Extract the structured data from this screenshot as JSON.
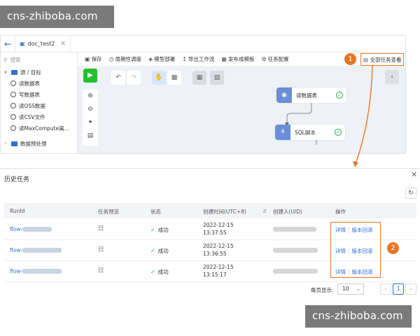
{
  "watermark": "cns-zhiboba.com",
  "tab": {
    "title": "doc_test2"
  },
  "search": {
    "placeholder": "搜索"
  },
  "tree": [
    {
      "label": "源 / 目标"
    },
    {
      "label": "读数据表"
    },
    {
      "label": "写数据表"
    },
    {
      "label": "读OSS数据"
    },
    {
      "label": "读CSV文件"
    },
    {
      "label": "读MaxCompute离..."
    },
    {
      "label": "数据预处理"
    }
  ],
  "toolbar": {
    "save": "保存",
    "schedule": "周期性调度",
    "deploy": "模型部署",
    "export": "导出工作流",
    "publish": "发布成模板",
    "config": "任务配置",
    "all_tasks": "全部任务查看"
  },
  "nodes": [
    {
      "label": "读数据表"
    },
    {
      "label": "SQL脚本"
    }
  ],
  "badges": {
    "one": "1",
    "two": "2"
  },
  "history": {
    "title": "历史任务",
    "columns": {
      "runid": "RunId",
      "preview": "任务预览",
      "status": "状态",
      "created": "创建时间(UTC+8)",
      "creator": "创建人(UID)",
      "ops": "操作"
    },
    "rows": [
      {
        "runid": "flow-",
        "status": "成功",
        "date": "2022-12-15",
        "time": "13:37:55",
        "detail": "详情",
        "rollback": "版本回滚"
      },
      {
        "runid": "flow-",
        "status": "成功",
        "date": "2022-12-15",
        "time": "13:36:55",
        "detail": "详情",
        "rollback": "版本回滚"
      },
      {
        "runid": "flow-",
        "status": "成功",
        "date": "2022-12-15",
        "time": "13:15:17",
        "detail": "详情",
        "rollback": "版本回滚"
      }
    ],
    "pager": {
      "per_page_label": "每页显示:",
      "per_page": "10",
      "page": "1"
    }
  }
}
